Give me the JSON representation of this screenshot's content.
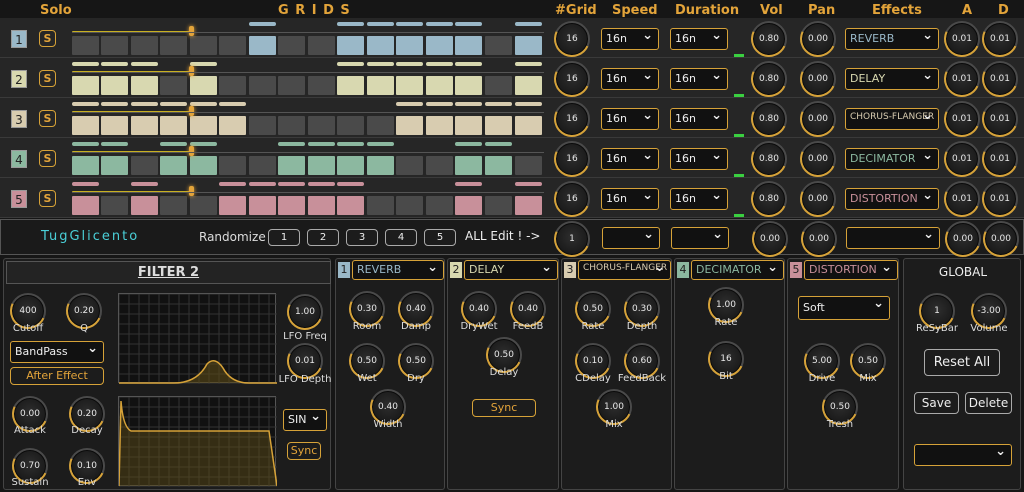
{
  "headers": {
    "solo": "Solo",
    "grids": "G R I D S",
    "grid": "#Grid",
    "speed": "Speed",
    "duration": "Duration",
    "vol": "Vol",
    "pan": "Pan",
    "effects": "Effects",
    "a": "A",
    "d": "D"
  },
  "tracks": [
    {
      "num": "1",
      "solo": "S",
      "color": "#9ab8c8",
      "grid": "16",
      "speed": "16n",
      "duration": "16n",
      "vol": "0.80",
      "pan": "0.00",
      "effect": "REVERB",
      "a": "0.01",
      "d": "0.01"
    },
    {
      "num": "2",
      "solo": "S",
      "color": "#d8d8b0",
      "grid": "16",
      "speed": "16n",
      "duration": "16n",
      "vol": "0.80",
      "pan": "0.00",
      "effect": "DELAY",
      "a": "0.01",
      "d": "0.01"
    },
    {
      "num": "3",
      "solo": "S",
      "color": "#d8ccb0",
      "grid": "16",
      "speed": "16n",
      "duration": "16n",
      "vol": "0.80",
      "pan": "0.00",
      "effect": "CHORUS-FLANGER",
      "a": "0.01",
      "d": "0.01"
    },
    {
      "num": "4",
      "solo": "S",
      "color": "#8cb8a0",
      "grid": "16",
      "speed": "16n",
      "duration": "16n",
      "vol": "0.80",
      "pan": "0.00",
      "effect": "DECIMATOR",
      "a": "0.01",
      "d": "0.01"
    },
    {
      "num": "5",
      "solo": "S",
      "color": "#c8909a",
      "grid": "16",
      "speed": "16n",
      "duration": "16n",
      "vol": "0.80",
      "pan": "0.00",
      "effect": "DISTORTION",
      "a": "0.01",
      "d": "0.01"
    }
  ],
  "patterns": [
    [
      0,
      0,
      0,
      0,
      0,
      0,
      1,
      0,
      0,
      1,
      1,
      1,
      1,
      1,
      0,
      1
    ],
    [
      1,
      1,
      1,
      0,
      1,
      0,
      0,
      0,
      0,
      1,
      1,
      1,
      1,
      1,
      0,
      1
    ],
    [
      1,
      1,
      1,
      1,
      1,
      1,
      0,
      0,
      0,
      0,
      0,
      1,
      1,
      1,
      1,
      1
    ],
    [
      1,
      1,
      0,
      1,
      1,
      0,
      0,
      1,
      1,
      1,
      1,
      0,
      0,
      1,
      1,
      0
    ],
    [
      1,
      0,
      1,
      0,
      0,
      1,
      1,
      1,
      1,
      1,
      0,
      0,
      0,
      1,
      0,
      1
    ]
  ],
  "master": {
    "brand": "TugGlicento",
    "randomize": "Randomize",
    "rand_buttons": [
      "1",
      "2",
      "3",
      "4",
      "5"
    ],
    "all_edit": "ALL Edit ! ->",
    "grid": "1",
    "vol": "0.00",
    "pan": "0.00",
    "a": "0.00",
    "d": "0.00"
  },
  "filter": {
    "title": "FILTER 2",
    "cutoff": {
      "value": "400",
      "label": "Cutoff"
    },
    "q": {
      "value": "0.20",
      "label": "Q"
    },
    "type": "BandPass",
    "after": "After Effect",
    "lfo_freq": {
      "value": "1.00",
      "label": "LFO Freq"
    },
    "lfo_depth": {
      "value": "0.01",
      "label": "LFO Depth"
    },
    "attack": {
      "value": "0.00",
      "label": "Attack"
    },
    "decay": {
      "value": "0.20",
      "label": "Decay"
    },
    "sustain": {
      "value": "0.70",
      "label": "Sustain"
    },
    "env": {
      "value": "0.10",
      "label": "Env"
    },
    "wave": "SIN",
    "sync": "Sync"
  },
  "fx": [
    {
      "num": "1",
      "name": "REVERB",
      "color": "#9ab8c8",
      "knobs": [
        {
          "value": "0.30",
          "label": "Room"
        },
        {
          "value": "0.40",
          "label": "Damp"
        },
        {
          "value": "0.50",
          "label": "Wet"
        },
        {
          "value": "0.50",
          "label": "Dry"
        },
        {
          "value": "0.40",
          "label": "Width"
        }
      ]
    },
    {
      "num": "2",
      "name": "DELAY",
      "color": "#d8d8b0",
      "knobs": [
        {
          "value": "0.40",
          "label": "DryWet"
        },
        {
          "value": "0.40",
          "label": "FeedB"
        },
        {
          "value": "0.50",
          "label": "Delay"
        }
      ],
      "sync": "Sync"
    },
    {
      "num": "3",
      "name": "CHORUS-FLANGER",
      "color": "#d8ccb0",
      "knobs": [
        {
          "value": "0.50",
          "label": "Rate"
        },
        {
          "value": "0.30",
          "label": "Depth"
        },
        {
          "value": "0.10",
          "label": "CDelay"
        },
        {
          "value": "0.60",
          "label": "FeedBack"
        },
        {
          "value": "1.00",
          "label": "Mix"
        }
      ]
    },
    {
      "num": "4",
      "name": "DECIMATOR",
      "color": "#8cb8a0",
      "knobs": [
        {
          "value": "1.00",
          "label": "Rate"
        },
        {
          "value": "16",
          "label": "Bit"
        }
      ]
    },
    {
      "num": "5",
      "name": "DISTORTION",
      "color": "#c8909a",
      "mode": "Soft",
      "knobs": [
        {
          "value": "5.00",
          "label": "Drive"
        },
        {
          "value": "0.50",
          "label": "Mix"
        },
        {
          "value": "0.50",
          "label": "Tresh"
        }
      ]
    }
  ],
  "global": {
    "title": "GLOBAL",
    "resybar": {
      "value": "1",
      "label": "ReSyBar"
    },
    "volume": {
      "value": "-3.00",
      "label": "Volume"
    },
    "reset": "Reset All",
    "save": "Save",
    "delete": "Delete",
    "preset": ""
  }
}
